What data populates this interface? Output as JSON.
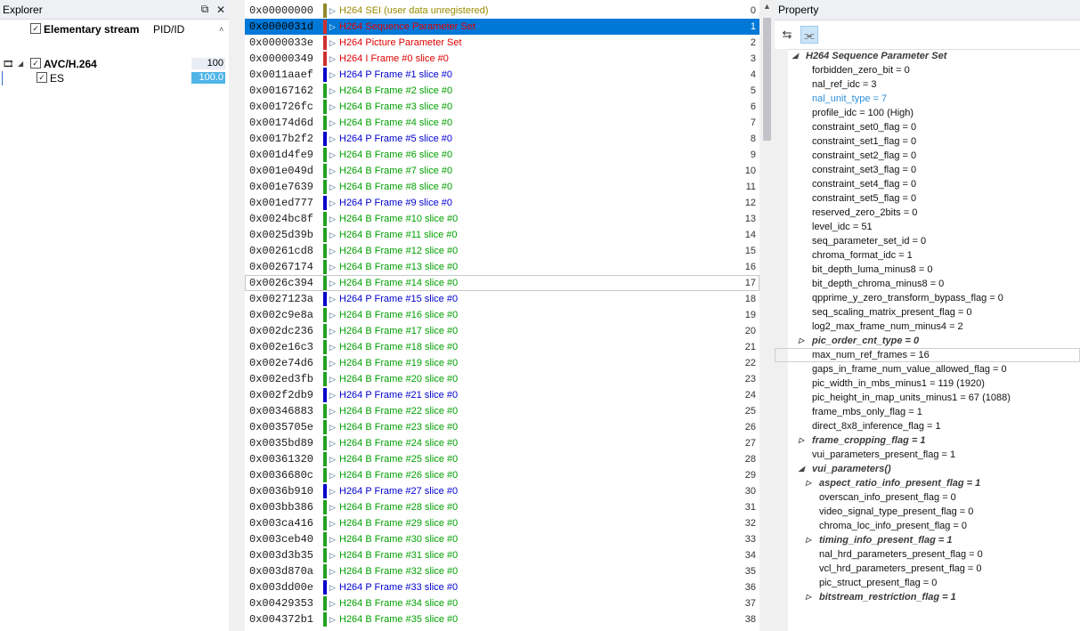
{
  "explorer": {
    "title": "Explorer",
    "header": {
      "label": "Elementary stream",
      "pid_col": "PID/ID"
    },
    "nodes": [
      {
        "label": "AVC/H.264",
        "value": "100"
      },
      {
        "label": "ES",
        "value": "100.0"
      }
    ]
  },
  "packets": {
    "selected_index": 1,
    "outlined_index": 17,
    "rows": [
      {
        "addr": "0x00000000",
        "name": "H264 SEI (user data unregistered)",
        "idx": "0",
        "type": "sei"
      },
      {
        "addr": "0x0000031d",
        "name": "H264 Sequence Parameter Set",
        "idx": "1",
        "type": "sps"
      },
      {
        "addr": "0x0000033e",
        "name": "H264 Picture Parameter Set",
        "idx": "2",
        "type": "pps"
      },
      {
        "addr": "0x00000349",
        "name": "H264 I Frame #0 slice #0",
        "idx": "3",
        "type": "i"
      },
      {
        "addr": "0x0011aaef",
        "name": "H264 P Frame #1 slice #0",
        "idx": "4",
        "type": "p"
      },
      {
        "addr": "0x00167162",
        "name": "H264 B Frame #2 slice #0",
        "idx": "5",
        "type": "b"
      },
      {
        "addr": "0x001726fc",
        "name": "H264 B Frame #3 slice #0",
        "idx": "6",
        "type": "b"
      },
      {
        "addr": "0x00174d6d",
        "name": "H264 B Frame #4 slice #0",
        "idx": "7",
        "type": "b"
      },
      {
        "addr": "0x0017b2f2",
        "name": "H264 P Frame #5 slice #0",
        "idx": "8",
        "type": "p"
      },
      {
        "addr": "0x001d4fe9",
        "name": "H264 B Frame #6 slice #0",
        "idx": "9",
        "type": "b"
      },
      {
        "addr": "0x001e049d",
        "name": "H264 B Frame #7 slice #0",
        "idx": "10",
        "type": "b"
      },
      {
        "addr": "0x001e7639",
        "name": "H264 B Frame #8 slice #0",
        "idx": "11",
        "type": "b"
      },
      {
        "addr": "0x001ed777",
        "name": "H264 P Frame #9 slice #0",
        "idx": "12",
        "type": "p"
      },
      {
        "addr": "0x0024bc8f",
        "name": "H264 B Frame #10 slice #0",
        "idx": "13",
        "type": "b"
      },
      {
        "addr": "0x0025d39b",
        "name": "H264 B Frame #11 slice #0",
        "idx": "14",
        "type": "b"
      },
      {
        "addr": "0x00261cd8",
        "name": "H264 B Frame #12 slice #0",
        "idx": "15",
        "type": "b"
      },
      {
        "addr": "0x00267174",
        "name": "H264 B Frame #13 slice #0",
        "idx": "16",
        "type": "b"
      },
      {
        "addr": "0x0026c394",
        "name": "H264 B Frame #14 slice #0",
        "idx": "17",
        "type": "b"
      },
      {
        "addr": "0x0027123a",
        "name": "H264 P Frame #15 slice #0",
        "idx": "18",
        "type": "p"
      },
      {
        "addr": "0x002c9e8a",
        "name": "H264 B Frame #16 slice #0",
        "idx": "19",
        "type": "b"
      },
      {
        "addr": "0x002dc236",
        "name": "H264 B Frame #17 slice #0",
        "idx": "20",
        "type": "b"
      },
      {
        "addr": "0x002e16c3",
        "name": "H264 B Frame #18 slice #0",
        "idx": "21",
        "type": "b"
      },
      {
        "addr": "0x002e74d6",
        "name": "H264 B Frame #19 slice #0",
        "idx": "22",
        "type": "b"
      },
      {
        "addr": "0x002ed3fb",
        "name": "H264 B Frame #20 slice #0",
        "idx": "23",
        "type": "b"
      },
      {
        "addr": "0x002f2db9",
        "name": "H264 P Frame #21 slice #0",
        "idx": "24",
        "type": "p"
      },
      {
        "addr": "0x00346883",
        "name": "H264 B Frame #22 slice #0",
        "idx": "25",
        "type": "b"
      },
      {
        "addr": "0x0035705e",
        "name": "H264 B Frame #23 slice #0",
        "idx": "26",
        "type": "b"
      },
      {
        "addr": "0x0035bd89",
        "name": "H264 B Frame #24 slice #0",
        "idx": "27",
        "type": "b"
      },
      {
        "addr": "0x00361320",
        "name": "H264 B Frame #25 slice #0",
        "idx": "28",
        "type": "b"
      },
      {
        "addr": "0x0036680c",
        "name": "H264 B Frame #26 slice #0",
        "idx": "29",
        "type": "b"
      },
      {
        "addr": "0x0036b910",
        "name": "H264 P Frame #27 slice #0",
        "idx": "30",
        "type": "p"
      },
      {
        "addr": "0x003bb386",
        "name": "H264 B Frame #28 slice #0",
        "idx": "31",
        "type": "b"
      },
      {
        "addr": "0x003ca416",
        "name": "H264 B Frame #29 slice #0",
        "idx": "32",
        "type": "b"
      },
      {
        "addr": "0x003ceb40",
        "name": "H264 B Frame #30 slice #0",
        "idx": "33",
        "type": "b"
      },
      {
        "addr": "0x003d3b35",
        "name": "H264 B Frame #31 slice #0",
        "idx": "34",
        "type": "b"
      },
      {
        "addr": "0x003d870a",
        "name": "H264 B Frame #32 slice #0",
        "idx": "35",
        "type": "b"
      },
      {
        "addr": "0x003dd00e",
        "name": "H264 P Frame #33 slice #0",
        "idx": "36",
        "type": "p"
      },
      {
        "addr": "0x00429353",
        "name": "H264 B Frame #34 slice #0",
        "idx": "37",
        "type": "b"
      },
      {
        "addr": "0x004372b1",
        "name": "H264 B Frame #35 slice #0",
        "idx": "38",
        "type": "b"
      }
    ],
    "colors": {
      "sei": {
        "text": "#9a8a00",
        "bar": "#8f8a2a"
      },
      "sps": {
        "text": "#e00000",
        "bar": "#d03030"
      },
      "pps": {
        "text": "#e00000",
        "bar": "#d03030"
      },
      "i": {
        "text": "#e00000",
        "bar": "#d03030"
      },
      "p": {
        "text": "#0000d0",
        "bar": "#0000c8"
      },
      "b": {
        "text": "#00a000",
        "bar": "#22a022"
      }
    }
  },
  "property": {
    "title": "Property",
    "highlight_row": 21,
    "fields": [
      {
        "label": "H264 Sequence Parameter Set",
        "level": 0,
        "expander": "open",
        "style": "bold"
      },
      {
        "label": "forbidden_zero_bit  =  0",
        "level": 1
      },
      {
        "label": "nal_ref_idc  =  3",
        "level": 1
      },
      {
        "label": "nal_unit_type  =  7",
        "level": 1,
        "style": "hl"
      },
      {
        "label": "profile_idc  =  100 (High)",
        "level": 1
      },
      {
        "label": "constraint_set0_flag  =  0",
        "level": 1
      },
      {
        "label": "constraint_set1_flag  =  0",
        "level": 1
      },
      {
        "label": "constraint_set2_flag  =  0",
        "level": 1
      },
      {
        "label": "constraint_set3_flag  =  0",
        "level": 1
      },
      {
        "label": "constraint_set4_flag  =  0",
        "level": 1
      },
      {
        "label": "constraint_set5_flag  =  0",
        "level": 1
      },
      {
        "label": "reserved_zero_2bits  =  0",
        "level": 1
      },
      {
        "label": "level_idc  =  51",
        "level": 1
      },
      {
        "label": "seq_parameter_set_id  =  0",
        "level": 1
      },
      {
        "label": "chroma_format_idc  =  1",
        "level": 1
      },
      {
        "label": "bit_depth_luma_minus8  =  0",
        "level": 1
      },
      {
        "label": "bit_depth_chroma_minus8  =  0",
        "level": 1
      },
      {
        "label": "qpprime_y_zero_transform_bypass_flag  =  0",
        "level": 1
      },
      {
        "label": "seq_scaling_matrix_present_flag  =  0",
        "level": 1
      },
      {
        "label": "log2_max_frame_num_minus4  =  2",
        "level": 1
      },
      {
        "label": "pic_order_cnt_type  =  0",
        "level": 1,
        "expander": "closed",
        "style": "bold"
      },
      {
        "label": "max_num_ref_frames  =  16",
        "level": 1
      },
      {
        "label": "gaps_in_frame_num_value_allowed_flag  =  0",
        "level": 1
      },
      {
        "label": "pic_width_in_mbs_minus1  =  119 (1920)",
        "level": 1
      },
      {
        "label": "pic_height_in_map_units_minus1  =  67 (1088)",
        "level": 1
      },
      {
        "label": "frame_mbs_only_flag  =  1",
        "level": 1
      },
      {
        "label": "direct_8x8_inference_flag  =  1",
        "level": 1
      },
      {
        "label": "frame_cropping_flag  =  1",
        "level": 1,
        "expander": "closed",
        "style": "bold"
      },
      {
        "label": "vui_parameters_present_flag  =  1",
        "level": 1
      },
      {
        "label": "vui_parameters()",
        "level": 1,
        "expander": "open",
        "style": "bold"
      },
      {
        "label": "aspect_ratio_info_present_flag  =  1",
        "level": 2,
        "expander": "closed",
        "style": "bold"
      },
      {
        "label": "overscan_info_present_flag  =  0",
        "level": 2
      },
      {
        "label": "video_signal_type_present_flag  =  0",
        "level": 2
      },
      {
        "label": "chroma_loc_info_present_flag  =  0",
        "level": 2
      },
      {
        "label": "timing_info_present_flag  =  1",
        "level": 2,
        "expander": "closed",
        "style": "bold"
      },
      {
        "label": "nal_hrd_parameters_present_flag  =  0",
        "level": 2
      },
      {
        "label": "vcl_hrd_parameters_present_flag  =  0",
        "level": 2
      },
      {
        "label": "pic_struct_present_flag  =  0",
        "level": 2
      },
      {
        "label": "bitstream_restriction_flag  =  1",
        "level": 2,
        "expander": "closed",
        "style": "bold"
      }
    ]
  }
}
